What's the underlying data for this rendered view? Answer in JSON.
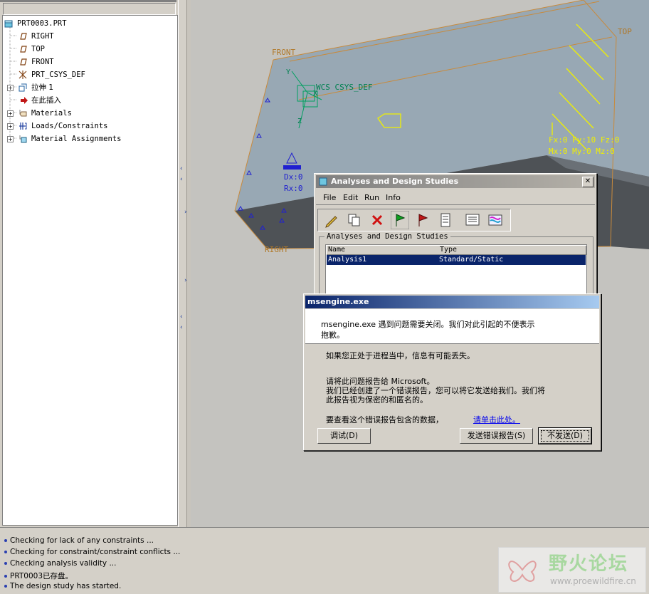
{
  "model_tree": {
    "items": [
      {
        "label": "PRT0003.PRT",
        "icon": "part-icon"
      },
      {
        "label": "RIGHT",
        "icon": "datum-plane-icon"
      },
      {
        "label": "TOP",
        "icon": "datum-plane-icon"
      },
      {
        "label": "FRONT",
        "icon": "datum-plane-icon"
      },
      {
        "label": "PRT_CSYS_DEF",
        "icon": "csys-icon"
      },
      {
        "label": "拉伸 1",
        "icon": "extrude-icon"
      },
      {
        "label": "在此插入",
        "icon": "insert-arrow-icon"
      },
      {
        "label": "Materials",
        "icon": "materials-icon"
      },
      {
        "label": "Loads/Constraints",
        "icon": "loads-icon"
      },
      {
        "label": "Material Assignments",
        "icon": "material-assign-icon"
      }
    ]
  },
  "graphics": {
    "labels": {
      "top": "TOP",
      "front": "FRONT",
      "right": "RIGHT",
      "csys": "WCS CSYS_DEF",
      "force": "Fx:0 Fy:10 Fz:0",
      "moment": "Mx:0 My:0 Mz:0",
      "disp": "Dx:0",
      "rot": "Rx:0",
      "axis_x": "X",
      "axis_y": "Y",
      "axis_z": "Z"
    }
  },
  "analyses_dialog": {
    "title": "Analyses and Design Studies",
    "menu": [
      "File",
      "Edit",
      "Run",
      "Info"
    ],
    "group_label": "Analyses and Design Studies",
    "columns": [
      "Name",
      "Type"
    ],
    "rows": [
      {
        "name": "Analysis1",
        "type": "Standard/Static"
      }
    ]
  },
  "error_dialog": {
    "title": "msengine.exe",
    "line1": "msengine.exe 遇到问题需要关闭。我们对此引起的不便表示",
    "line2": "抱歉。",
    "info": "如果您正处于进程当中，信息有可能丢失。",
    "report1": "请将此问题报告给 Microsoft。",
    "report2": "我们已经创建了一个错误报告，您可以将它发送给我们。我们将",
    "report3": "此报告视为保密的和匿名的。",
    "view_data": "要查看这个错误报告包含的数据，",
    "link": "请单击此处。",
    "debug_btn": "调试(D)",
    "send_btn": "发送错误报告(S)",
    "dont_send_btn": "不发送(D)"
  },
  "messages": [
    "Checking for lack of any constraints ...",
    "Checking for constraint/constraint conflicts ...",
    "Checking analysis validity ...",
    "PRT0003已存盘。",
    "The design study has started."
  ],
  "watermark": {
    "title": "野火论坛",
    "url": "www.proewildfire.cn"
  },
  "colors": {
    "dialog_title_active": "#0a246a",
    "selection": "#0a246a",
    "datum_orange": "#c88a3c",
    "load_yellow": "#f0f000",
    "constraint_blue": "#2020d0"
  }
}
